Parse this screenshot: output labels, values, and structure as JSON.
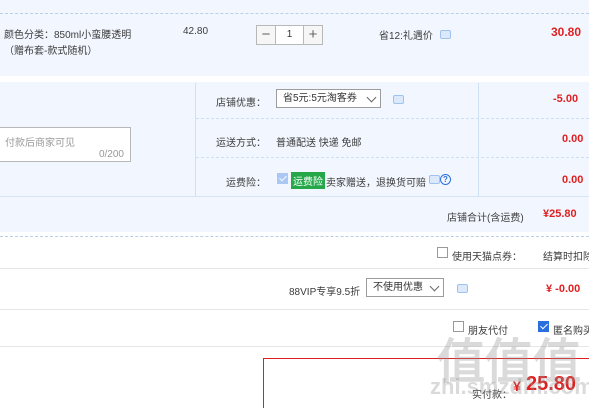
{
  "item": {
    "spec_line1": "颜色分类：850ml小蛮腰透明",
    "spec_line2": "（赠布套-款式随机）",
    "unit_price": "42.80",
    "quantity": "1",
    "minus_label": "−",
    "plus_label": "+",
    "discount_text": "省12:礼遇价",
    "subtotal": "30.80"
  },
  "message": {
    "placeholder": "付款后商家可见",
    "counter": "0/200"
  },
  "shop_discount": {
    "label": "店铺优惠：",
    "selected": "省5元:5元淘客券",
    "amount": "-5.00"
  },
  "shipping": {
    "label": "运送方式：",
    "value": "普通配送 快递 免邮",
    "amount": "0.00"
  },
  "freight_insurance": {
    "label": "运费险：",
    "badge": "运费险",
    "text": "卖家赠送，退换货可赔",
    "amount": "0.00"
  },
  "shop_total": {
    "label": "店铺合计(含运费)",
    "amount": "¥25.80"
  },
  "tmall_points": {
    "label": "使用天猫点券：",
    "settle_text": "结算时扣除"
  },
  "vip": {
    "label": "88VIP专享9.5折",
    "selected": "不使用优惠",
    "amount": "¥ -0.00"
  },
  "payment_options": {
    "friend_pay": "朋友代付",
    "anonymous": "匿名购买"
  },
  "final": {
    "label": "实付款：",
    "currency": "¥",
    "amount": "25.80"
  },
  "watermark": {
    "glyphs": "值值值",
    "text": "zhi.smzdm.com"
  },
  "colors": {
    "accent_red": "#e02020",
    "row_blue": "#f2f7ff",
    "checkbox_blue": "#2a6fe0",
    "badge_green": "#25a74a",
    "final_border": "#e02020"
  }
}
